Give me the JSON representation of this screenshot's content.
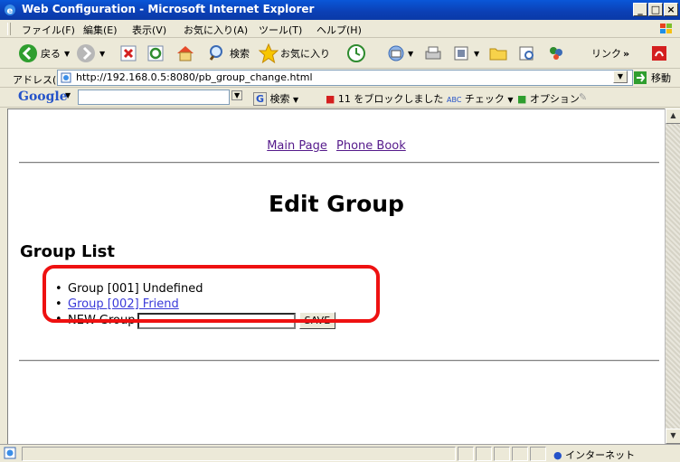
{
  "window": {
    "title": "Web Configuration - Microsoft Internet Explorer",
    "minimize": "_",
    "maximize": "□",
    "close": "×"
  },
  "menu": {
    "items": [
      "ファイル(F)",
      "編集(E)",
      "表示(V)",
      "お気に入り(A)",
      "ツール(T)",
      "ヘルプ(H)"
    ]
  },
  "toolbar": {
    "back_label": "戻る",
    "search_label": "検索",
    "favorites_label": "お気に入り",
    "links_label": "リンク",
    "more": "»"
  },
  "address": {
    "label": "アドレス(D)",
    "url": "http://192.168.0.5:8080/pb_group_change.html",
    "go_label": "移動"
  },
  "google": {
    "logo": "Google",
    "search_label": "検索",
    "blocked_label": "11 をブロックしました",
    "check_label": "チェック",
    "options_label": "オプション"
  },
  "page": {
    "nav": {
      "main": "Main Page",
      "phonebook": "Phone Book"
    },
    "title": "Edit Group",
    "section_title": "Group List",
    "groups": [
      {
        "text": "Group [001] Undefined",
        "link": false
      },
      {
        "text": "Group [002] Friend",
        "link": true
      }
    ],
    "new_group_label": "NEW Group",
    "new_group_value": "",
    "save_label": "SAVE"
  },
  "status": {
    "zone": "インターネット"
  },
  "colors": {
    "titlebar": "#0b3fb4",
    "visited_link": "#551a8b",
    "link": "#3a3ad9",
    "annotation": "#ee1111"
  }
}
